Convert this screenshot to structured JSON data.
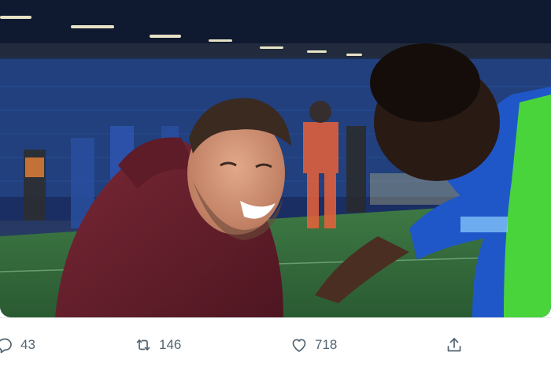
{
  "tweet": {
    "media": {
      "kind": "video-still",
      "subject_icon": "video-frame"
    },
    "actions": {
      "reply": {
        "icon": "reply-icon",
        "count": "43"
      },
      "retweet": {
        "icon": "retweet-icon",
        "count": "146"
      },
      "like": {
        "icon": "heart-icon",
        "count": "718"
      },
      "share": {
        "icon": "share-icon",
        "count": ""
      }
    }
  },
  "colors": {
    "icon": "#536471",
    "divider": "#e1e8ed",
    "pitch": "#2f6a3a",
    "stands": "#1f3f7a"
  }
}
